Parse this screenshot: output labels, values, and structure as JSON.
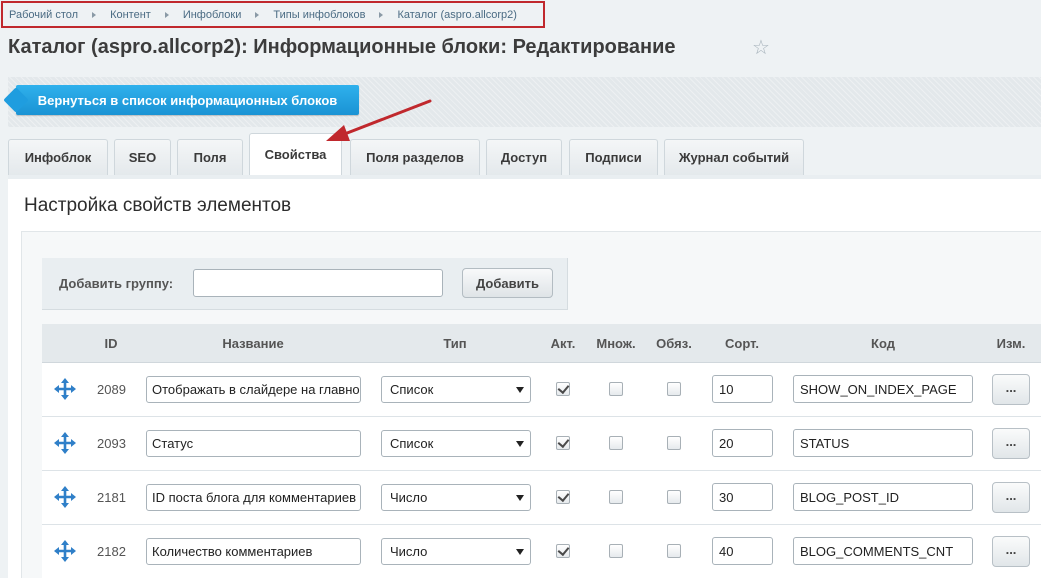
{
  "breadcrumb": [
    "Рабочий стол",
    "Контент",
    "Инфоблоки",
    "Типы инфоблоков",
    "Каталог (aspro.allcorp2)"
  ],
  "page_title": "Каталог (aspro.allcorp2): Информационные блоки: Редактирование",
  "back_button_label": "Вернуться в список информационных блоков",
  "tabs": [
    "Инфоблок",
    "SEO",
    "Поля",
    "Свойства",
    "Поля разделов",
    "Доступ",
    "Подписи",
    "Журнал событий"
  ],
  "active_tab": "Свойства",
  "section_title": "Настройка свойств элементов",
  "add_group": {
    "label": "Добавить группу:",
    "value": "",
    "button_label": "Добавить"
  },
  "table": {
    "headers": {
      "id": "ID",
      "name": "Название",
      "type": "Тип",
      "active": "Акт.",
      "multiple": "Множ.",
      "required": "Обяз.",
      "sort": "Сорт.",
      "code": "Код",
      "edit": "Изм."
    },
    "rows": [
      {
        "id": "2089",
        "name": "Отображать в слайдере на главной",
        "type": "Список",
        "active": true,
        "multiple": false,
        "required": false,
        "sort": "10",
        "code": "SHOW_ON_INDEX_PAGE",
        "edit": "..."
      },
      {
        "id": "2093",
        "name": "Статус",
        "type": "Список",
        "active": true,
        "multiple": false,
        "required": false,
        "sort": "20",
        "code": "STATUS",
        "edit": "..."
      },
      {
        "id": "2181",
        "name": "ID поста блога для комментариев",
        "type": "Число",
        "active": true,
        "multiple": false,
        "required": false,
        "sort": "30",
        "code": "BLOG_POST_ID",
        "edit": "..."
      },
      {
        "id": "2182",
        "name": "Количество комментариев",
        "type": "Число",
        "active": true,
        "multiple": false,
        "required": false,
        "sort": "40",
        "code": "BLOG_COMMENTS_CNT",
        "edit": "..."
      }
    ]
  },
  "colors": {
    "accent": "#1a93d4",
    "annotation": "#c0282d"
  }
}
